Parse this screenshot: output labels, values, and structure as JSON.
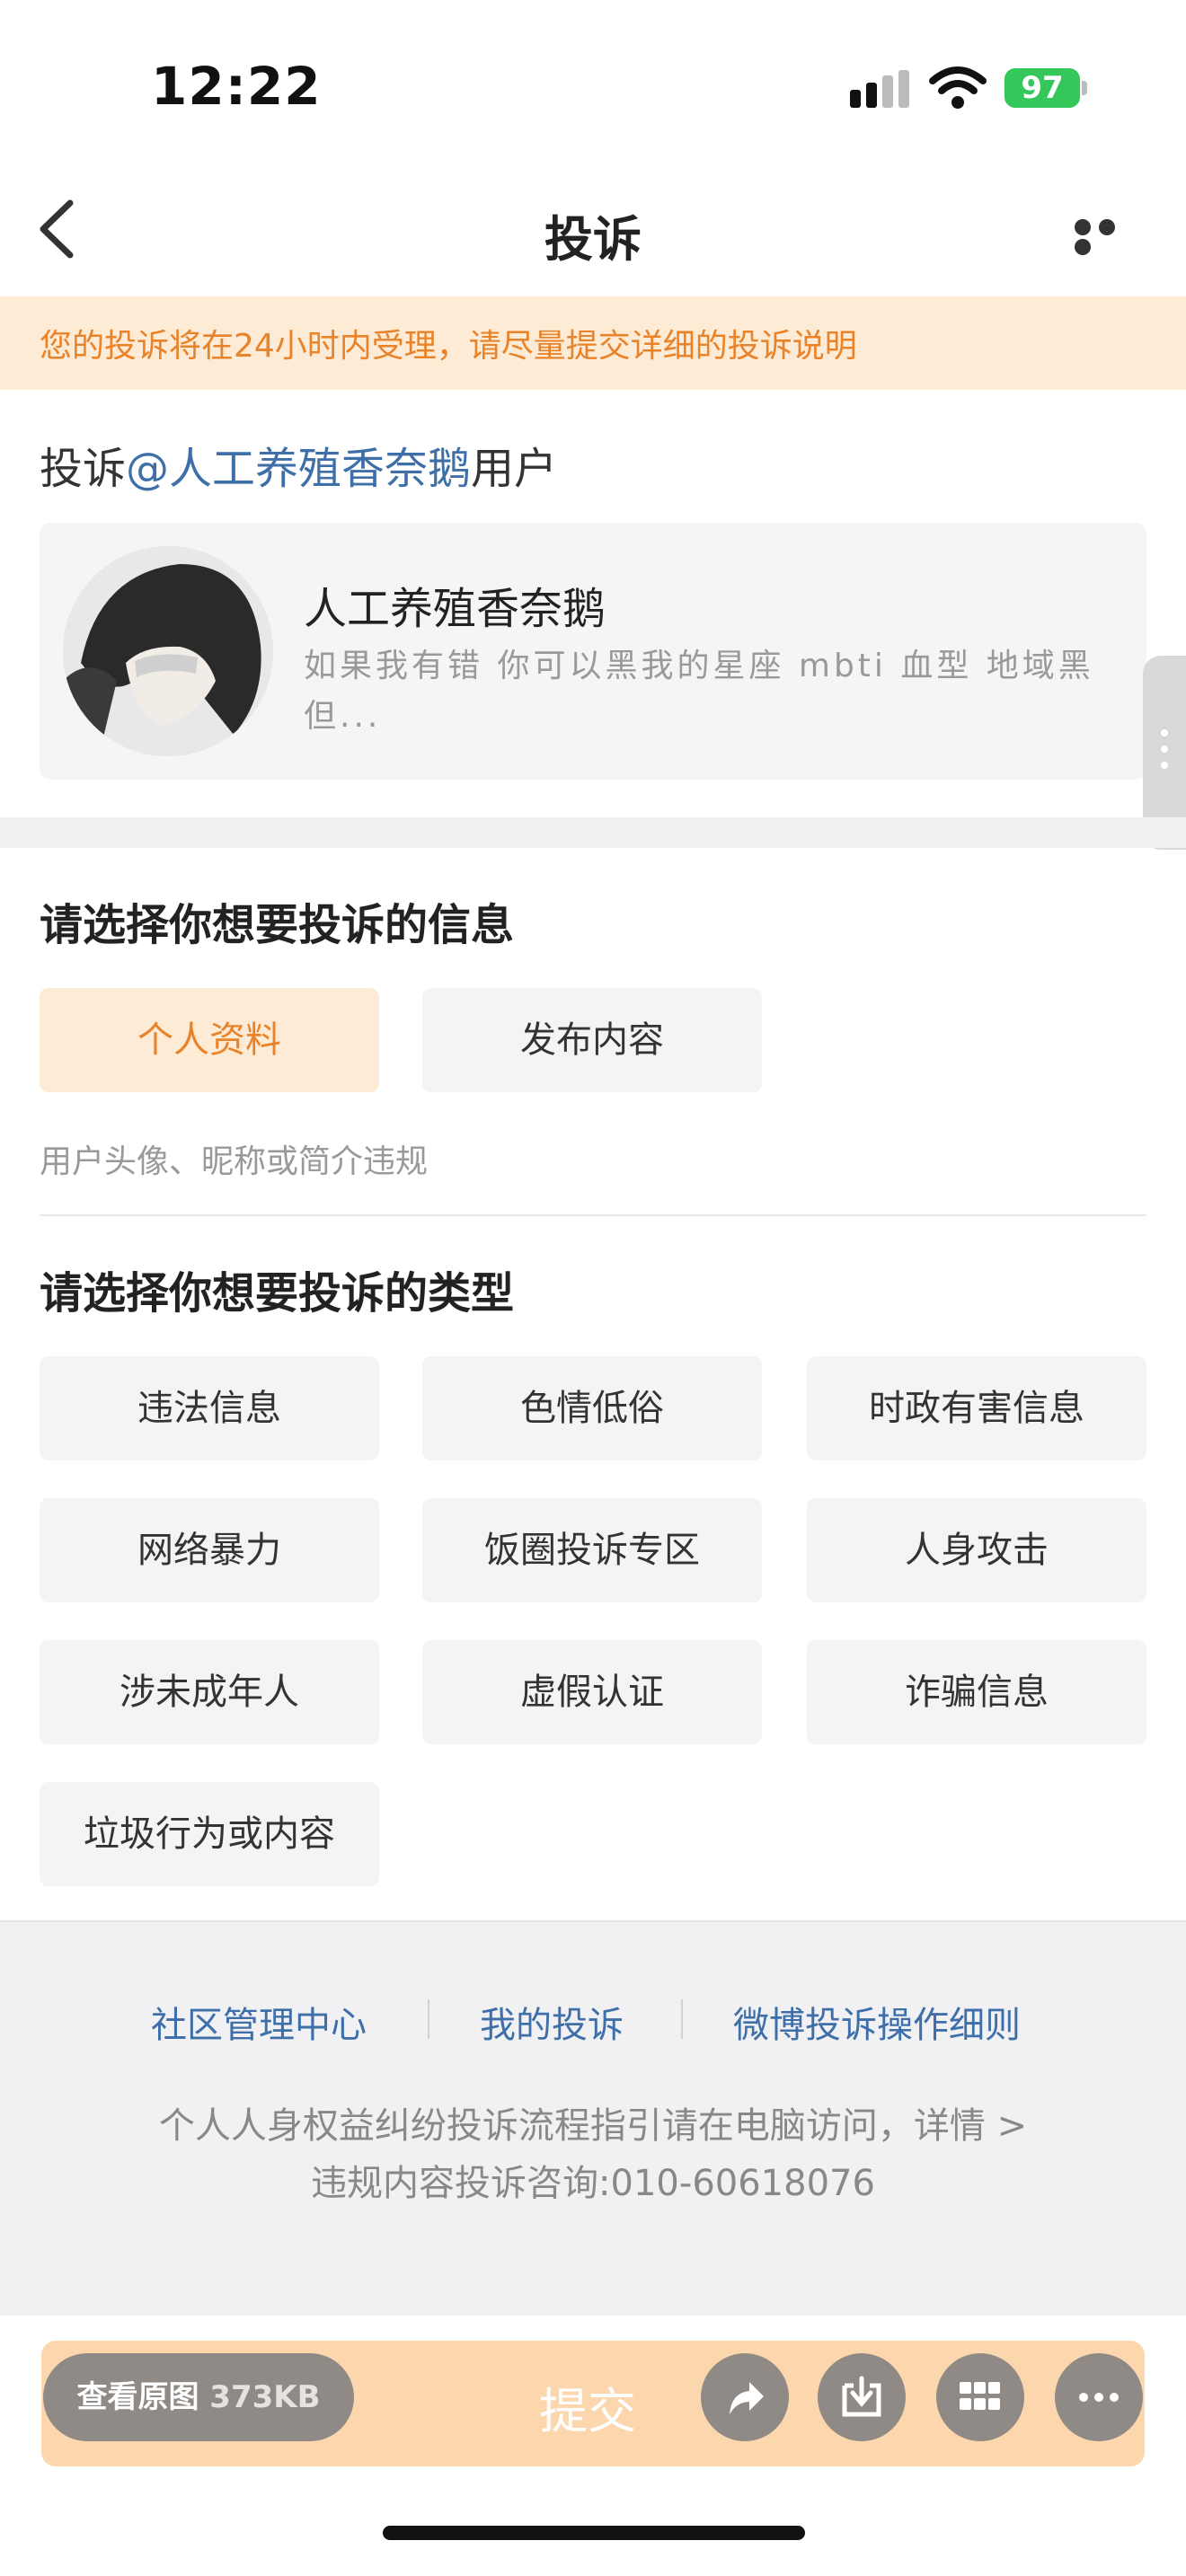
{
  "status_bar": {
    "time": "12:22",
    "battery": "97"
  },
  "nav": {
    "title": "投诉"
  },
  "notice": "您的投诉将在24小时内受理，请尽量提交详细的投诉说明",
  "target": {
    "prefix": "投诉",
    "mention": "@人工养殖香奈鹅",
    "suffix": "用户"
  },
  "user": {
    "name": "人工养殖香奈鹅",
    "bio": "如果我有错 你可以黑我的星座 mbti 血型 地域黑但..."
  },
  "info_section": {
    "title": "请选择你想要投诉的信息",
    "options": [
      "个人资料",
      "发布内容"
    ],
    "selected": "个人资料",
    "hint": "用户头像、昵称或简介违规"
  },
  "type_section": {
    "title": "请选择你想要投诉的类型",
    "options": [
      "违法信息",
      "色情低俗",
      "时政有害信息",
      "网络暴力",
      "饭圈投诉专区",
      "人身攻击",
      "涉未成年人",
      "虚假认证",
      "诈骗信息",
      "垃圾行为或内容"
    ]
  },
  "footer": {
    "links": [
      "社区管理中心",
      "我的投诉",
      "微博投诉操作细则"
    ],
    "guide": "个人人身权益纠纷投诉流程指引请在电脑访问，详情 >",
    "phone": "违规内容投诉咨询:010-60618076"
  },
  "bottom_bar": {
    "view_original": "查看原图",
    "size": "373KB",
    "submit": "提交"
  },
  "colors": {
    "accent": "#e9832a",
    "notice_bg": "#fdebd6",
    "link": "#3e6fa8"
  }
}
